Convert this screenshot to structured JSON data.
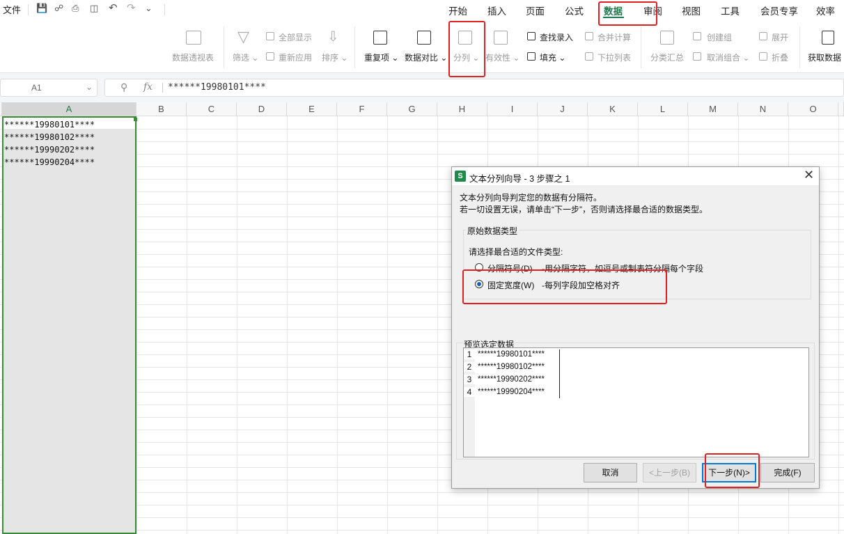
{
  "topbar": {
    "file_label": "文件",
    "tabs": [
      "开始",
      "插入",
      "页面",
      "公式",
      "数据",
      "审阅",
      "视图",
      "工具",
      "会员专享",
      "效率"
    ],
    "active_tab": "数据"
  },
  "ribbon": {
    "pivot": "数据透视表",
    "filter": "筛选",
    "show_all": "全部显示",
    "reapply": "重新应用",
    "sort": "排序",
    "duplicates": "重复项",
    "compare": "数据对比",
    "split": "分列",
    "validity": "有效性",
    "lookup": "查找录入",
    "fill": "填充",
    "consolidate": "合并计算",
    "dropdown_list": "下拉列表",
    "subtotal": "分类汇总",
    "create_group": "创建组",
    "ungroup": "取消组合",
    "expand": "展开",
    "collapse": "折叠",
    "get_data": "获取数据"
  },
  "formula_bar": {
    "name_box": "A1",
    "fx": "fx",
    "content": "******19980101****"
  },
  "grid": {
    "columns": [
      "A",
      "B",
      "C",
      "D",
      "E",
      "F",
      "G",
      "H",
      "I",
      "J",
      "K",
      "L",
      "M",
      "N",
      "O"
    ],
    "cells_A": [
      "******19980101****",
      "******19980102****",
      "******19990202****",
      "******19990204****"
    ]
  },
  "dialog": {
    "app_badge": "S",
    "title": "文本分列向导 - 3 步骤之 1",
    "desc1": "文本分列向导判定您的数据有分隔符。",
    "desc2": "若一切设置无误，请单击“下一步”，否则请选择最合适的数据类型。",
    "group_title": "原始数据类型",
    "prompt": "请选择最合适的文件类型:",
    "option1_label": "分隔符号(D)",
    "option1_desc": "-用分隔字符，如逗号或制表符分隔每个字段",
    "option2_label": "固定宽度(W)",
    "option2_desc": "-每列字段加空格对齐",
    "selected_option": "固定宽度(W)",
    "preview_title": "预览选定数据",
    "preview_numbers": [
      "1",
      "2",
      "3",
      "4"
    ],
    "preview_rows": [
      "******19980101****",
      "******19980102****",
      "******19990202****",
      "******19990204****"
    ],
    "buttons": {
      "cancel": "取消",
      "back": "<上一步(B)",
      "next": "下一步(N)>",
      "finish": "完成(F)"
    }
  }
}
